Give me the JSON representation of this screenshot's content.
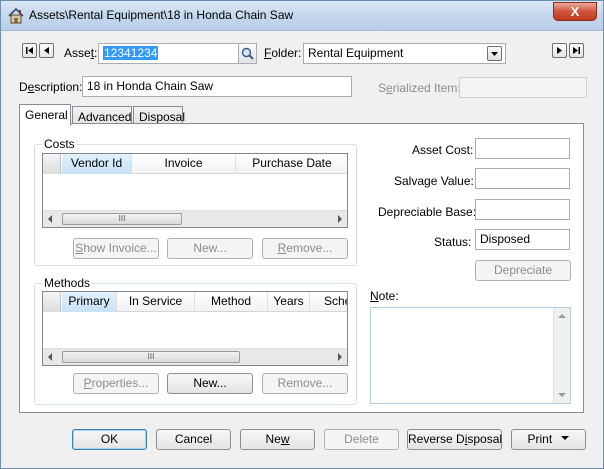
{
  "title_bar": {
    "title": "Assets\\Rental Equipment\\18 in Honda Chain Saw",
    "close_glyph": "X"
  },
  "record_nav": {
    "asset_label_prefix": "Asse",
    "asset_label_key": "t",
    "asset_label_suffix": ":",
    "asset_value": "12341234",
    "folder_label_key": "F",
    "folder_label_rest": "older:",
    "folder_value": "Rental Equipment"
  },
  "description": {
    "label_prefix": "D",
    "label_key": "e",
    "label_suffix": "scription:",
    "value": "18 in Honda Chain Saw"
  },
  "serialized": {
    "label_prefix": "S",
    "label_key": "e",
    "label_suffix": "rialized Item:",
    "value": ""
  },
  "tabs": [
    {
      "label": "General",
      "active": true
    },
    {
      "label": "Advanced",
      "active": false
    },
    {
      "label": "Disposal",
      "active": false
    }
  ],
  "costs_group": {
    "title": "Costs",
    "columns": [
      "Vendor Id",
      "Invoice",
      "Purchase Date"
    ],
    "rows": [],
    "scroll_thumb_glyph": "III",
    "buttons": {
      "show_invoice_key": "S",
      "show_invoice_rest": "how Invoice...",
      "new": "New...",
      "remove_key": "R",
      "remove_rest": "emove..."
    }
  },
  "methods_group": {
    "title": "Methods",
    "columns": [
      "Primary",
      "In Service",
      "Method",
      "Years",
      "Sche"
    ],
    "rows": [],
    "scroll_thumb_glyph": "III",
    "buttons": {
      "properties_key": "P",
      "properties_rest": "roperties...",
      "new": "New...",
      "remove": "Remove..."
    }
  },
  "values": {
    "asset_cost_label": "Asset Cost:",
    "asset_cost": "",
    "salvage_value_label": "Salvage Value:",
    "salvage_value": "",
    "depreciable_base_label": "Depreciable Base:",
    "depreciable_base": "",
    "status_label": "Status:",
    "status": "Disposed",
    "depreciate_button": "Depreciate",
    "note_label_key": "N",
    "note_label_rest": "ote:",
    "note": ""
  },
  "footer": {
    "ok": "OK",
    "cancel": "Cancel",
    "new_prefix": "Ne",
    "new_key": "w",
    "delete": "Delete",
    "reverse_prefix": "Reverse D",
    "reverse_key": "i",
    "reverse_suffix": "sposal",
    "print": "Print"
  }
}
